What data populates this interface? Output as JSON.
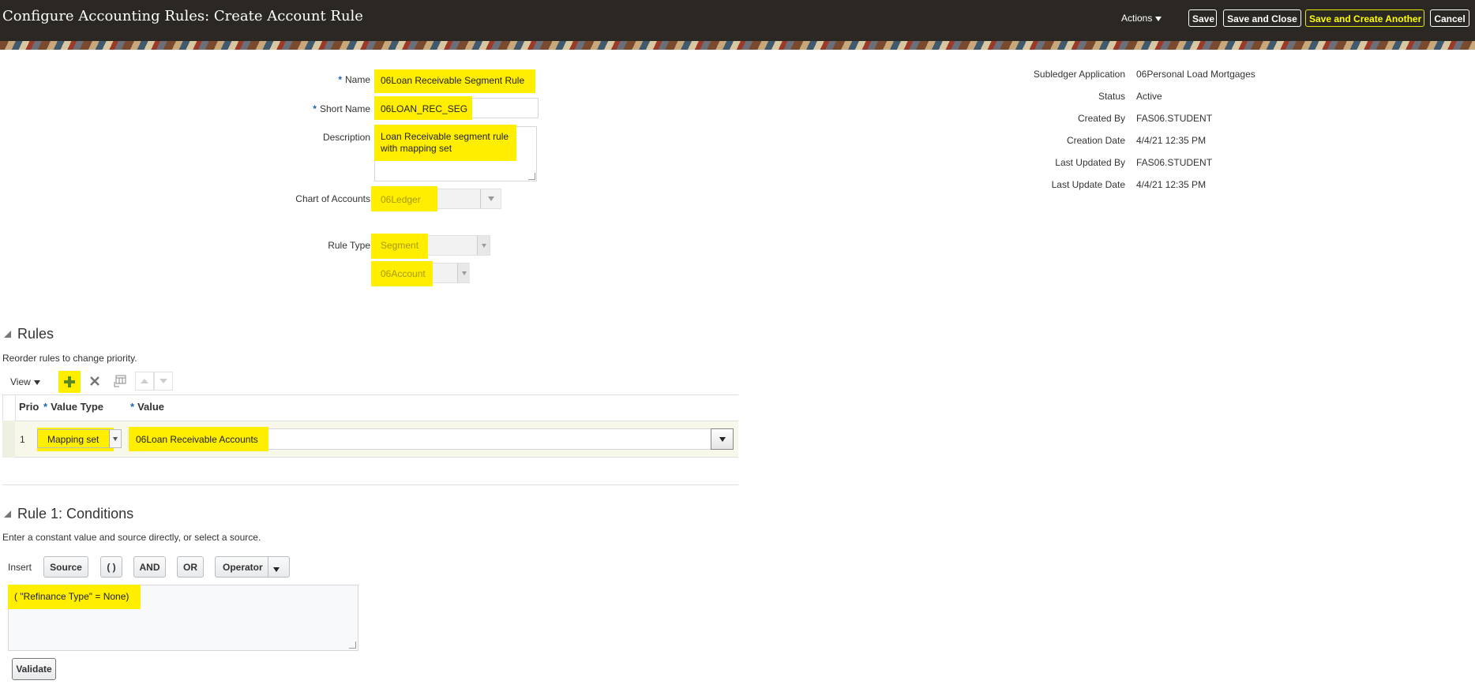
{
  "header": {
    "title": "Configure Accounting Rules: Create Account Rule",
    "actions_label": "Actions",
    "save_label": "Save",
    "save_close_label": "Save and Close",
    "save_create_another_label": "Save and Create Another",
    "cancel_label": "Cancel"
  },
  "form": {
    "name_label": "Name",
    "name_value": "06Loan Receivable Segment  Rule",
    "short_name_label": "Short Name",
    "short_name_value": "06LOAN_REC_SEG",
    "description_label": "Description",
    "description_value": "Loan Receivable segment rule with mapping set",
    "chart_of_accounts_label": "Chart of Accounts",
    "chart_of_accounts_value": "06Ledger",
    "rule_type_label": "Rule Type",
    "rule_type_value": "Segment",
    "segment_value": "06Account"
  },
  "info": {
    "subledger_label": "Subledger Application",
    "subledger_value": "06Personal Load Mortgages",
    "status_label": "Status",
    "status_value": "Active",
    "created_by_label": "Created By",
    "created_by_value": "FAS06.STUDENT",
    "creation_date_label": "Creation Date",
    "creation_date_value": "4/4/21 12:35 PM",
    "last_updated_by_label": "Last Updated By",
    "last_updated_by_value": "FAS06.STUDENT",
    "last_update_date_label": "Last Update Date",
    "last_update_date_value": "4/4/21 12:35 PM"
  },
  "rules": {
    "title": "Rules",
    "hint": "Reorder rules to change priority.",
    "view_label": "View",
    "columns": {
      "prio": "Prio",
      "value_type": "Value Type",
      "value": "Value"
    },
    "rows": [
      {
        "prio": "1",
        "value_type": "Mapping set",
        "value": "06Loan Receivable  Accounts"
      }
    ]
  },
  "conditions": {
    "title": "Rule 1: Conditions",
    "hint": "Enter a constant value and source directly, or select a source.",
    "insert_label": "Insert",
    "source_label": "Source",
    "paren_label": "( )",
    "and_label": "AND",
    "or_label": "OR",
    "operator_label": "Operator",
    "expression": "(  \"Refinance Type\" = None)",
    "validate_label": "Validate"
  },
  "colors": {
    "header_bg": "#2b2723",
    "highlight": "#ffee00",
    "required_star": "#1a64b4"
  }
}
